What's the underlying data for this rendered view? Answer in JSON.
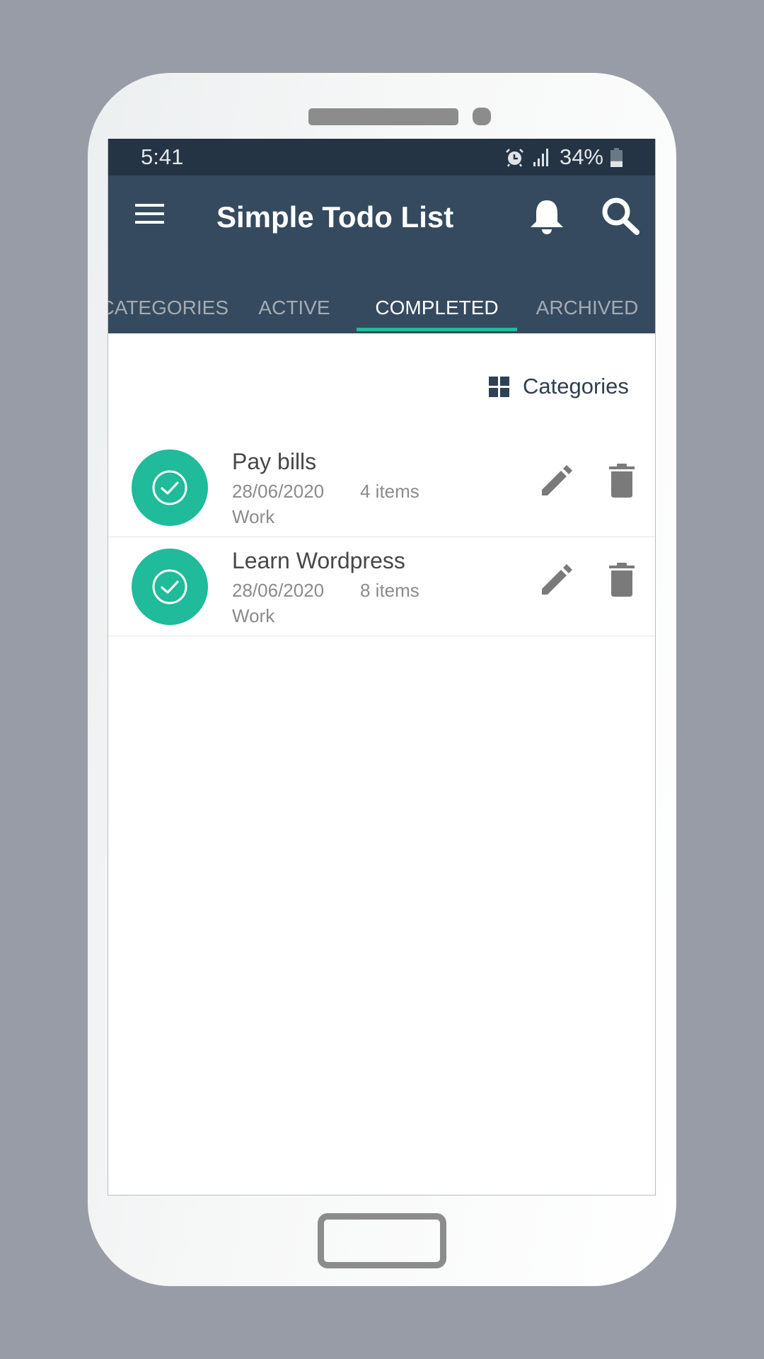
{
  "status_bar": {
    "time": "5:41",
    "battery_percent": "34%",
    "battery_level": 0.34,
    "icons": [
      "alarm-icon",
      "signal-icon",
      "battery-icon"
    ]
  },
  "app_bar": {
    "title": "Simple Todo List",
    "left_icon": "menu-icon",
    "right_icons": [
      "notifications-bell-icon",
      "search-icon"
    ]
  },
  "tabs": [
    {
      "label": "CATEGORIES",
      "active": false
    },
    {
      "label": "ACTIVE",
      "active": false
    },
    {
      "label": "COMPLETED",
      "active": true
    },
    {
      "label": "ARCHIVED",
      "active": false
    }
  ],
  "categories_button": {
    "label": "Categories",
    "icon": "grid-icon"
  },
  "todos": [
    {
      "title": "Pay bills",
      "date": "28/06/2020",
      "count": "4 items",
      "category": "Work",
      "status_icon": "check-circle-icon"
    },
    {
      "title": "Learn Wordpress",
      "date": "28/06/2020",
      "count": "8 items",
      "category": "Work",
      "status_icon": "check-circle-icon"
    }
  ],
  "colors": {
    "status_bar": "#253444",
    "app_bar": "#354a5f",
    "accent": "#1fbb9a",
    "tab_inactive": "#a4abb4",
    "action_icon": "#7a7a7a",
    "background": "#989ca6"
  }
}
